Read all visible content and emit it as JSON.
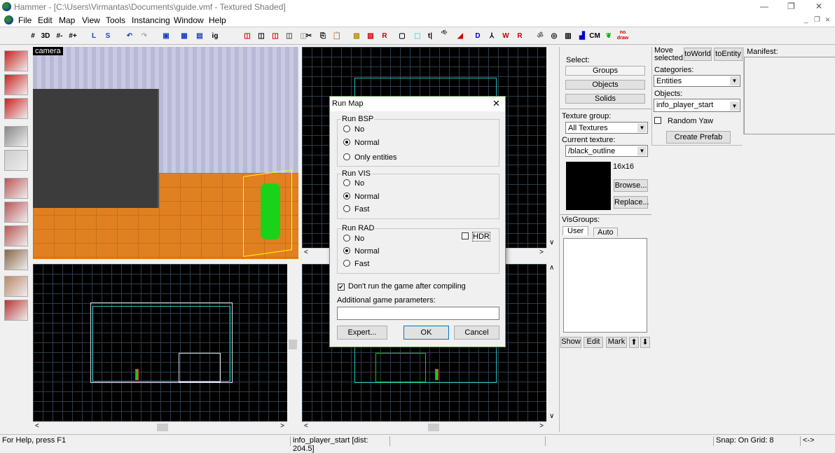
{
  "window": {
    "title": "Hammer - [C:\\Users\\Virmantas\\Documents\\guide.vmf - Textured Shaded]",
    "min": "—",
    "max": "❐",
    "close": "✕",
    "mdi_min": "_",
    "mdi_restore": "❐",
    "mdi_close": "×"
  },
  "menu": [
    "File",
    "Edit",
    "Map",
    "View",
    "Tools",
    "Instancing",
    "Window",
    "Help"
  ],
  "toolbar": [
    "#",
    "3D",
    "#-",
    "#+",
    "L",
    "S",
    "↶",
    "↷",
    "▣",
    "▦",
    "▤",
    "ig",
    "◫",
    "◫",
    "◫",
    "◫",
    "◫",
    "✂",
    "⎘",
    "📋",
    "▨",
    "▨",
    "R",
    "▢",
    "⬚",
    "t|",
    "‹t|›",
    "◢",
    "D",
    "⅄",
    "W",
    "R",
    "ॐ",
    "◎",
    "▥",
    "▟",
    "CM",
    "❦",
    "no draw"
  ],
  "left_tools": [
    "selection-tool",
    "magnify-tool",
    "camera-tool",
    "entity-tool",
    "block-tool",
    "texture-tool",
    "apply-texture-tool",
    "decal-tool",
    "overlay-tool",
    "clip-tool",
    "vertex-tool"
  ],
  "camera_label": "camera",
  "dialog": {
    "title": "Run Map",
    "close": "✕",
    "bsp": {
      "label": "Run BSP",
      "options": [
        "No",
        "Normal",
        "Only entities"
      ],
      "selected": 1
    },
    "vis": {
      "label": "Run VIS",
      "options": [
        "No",
        "Normal",
        "Fast"
      ],
      "selected": 1
    },
    "rad": {
      "label": "Run RAD",
      "options": [
        "No",
        "Normal",
        "Fast"
      ],
      "selected": 1,
      "hdr": "HDR",
      "hdr_checked": false
    },
    "dont_run": "Don't run the game after compiling",
    "dont_run_checked": true,
    "params_label": "Additional game parameters:",
    "params_value": "",
    "expert": "Expert...",
    "ok": "OK",
    "cancel": "Cancel"
  },
  "panel": {
    "select_label": "Select:",
    "groups": "Groups",
    "objects": "Objects",
    "solids": "Solids",
    "texture_group_label": "Texture group:",
    "texture_group": "All Textures",
    "current_texture_label": "Current texture:",
    "current_texture": "/black_outline",
    "texture_size": "16x16",
    "browse": "Browse...",
    "replace": "Replace...",
    "visgroups_label": "VisGroups:",
    "tab_user": "User",
    "tab_auto": "Auto",
    "show": "Show",
    "edit": "Edit",
    "mark": "Mark",
    "up": "⬆",
    "down": "⬇"
  },
  "entity": {
    "move_label": "Move selected:",
    "to_world": "toWorld",
    "to_entity": "toEntity",
    "categories_label": "Categories:",
    "categories": "Entities",
    "objects_label": "Objects:",
    "object": "info_player_start",
    "random_yaw": "Random Yaw",
    "create_prefab": "Create Prefab"
  },
  "manifest_label": "Manifest:",
  "status": {
    "help": "For Help, press F1",
    "selection": "info_player_start  [dist: 204.5]",
    "snap": "Snap: On Grid: 8",
    "arrows": "<->"
  }
}
